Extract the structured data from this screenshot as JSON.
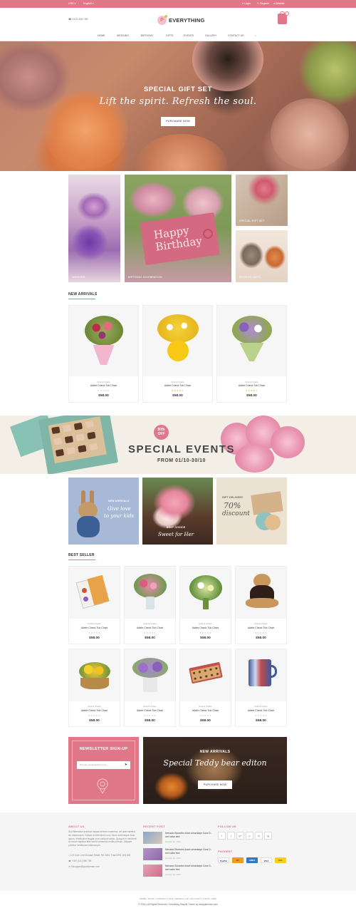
{
  "topbar": {
    "currency": "USD",
    "language": "English",
    "login": "Login",
    "register": "Register",
    "wishlist": "Wishlist"
  },
  "header": {
    "phone": "0123 456 789",
    "logo_text": "EVERYTHING",
    "cart_count": "0",
    "nav": [
      "HOME",
      "WEDDING",
      "BIRTHDAY",
      "GIFTS",
      "EVENTS",
      "GALLERY",
      "CONTACT US"
    ]
  },
  "hero": {
    "subtitle": "SPECIAL GIFT SET",
    "title": "Lift the spirit. Refresh the soul.",
    "button": "PURCHASE NOW"
  },
  "categories": {
    "wedding": "WEDDING",
    "birthday": "BIRTHDAY CELEBRATION",
    "birthday_card": "Happy Birthday",
    "gift": "SPECIAL GIFT SET",
    "plush": "STUFFED GIFTS"
  },
  "new_arrivals": {
    "title": "NEW ARRIVALS",
    "products": [
      {
        "category": "Sofa & Chairs",
        "name": "Adele Check Tub Chair",
        "price": "$58.00",
        "rating": 0
      },
      {
        "category": "Sofa & Chairs",
        "name": "Adele Check Tub Chair",
        "price": "$58.00",
        "rating": 4
      },
      {
        "category": "Sofa & Chairs",
        "name": "Adele Check Tub Chair",
        "price": "$58.00",
        "rating": 4
      }
    ]
  },
  "events_banner": {
    "badge_percent": "50%",
    "badge_off": "OFF",
    "title": "SPECIAL EVENTS",
    "date": "FROM 01/10-30/10"
  },
  "promos": {
    "bunny_tag": "NEW ARRIVALS",
    "bunny_line1": "Give love",
    "bunny_line2": "to your kids",
    "sweet_tag": "BEST CHOICE",
    "sweet_line": "Sweet for Her",
    "gift_tag": "GIFT DELIVERY",
    "gift_percent": "70%",
    "gift_line": "discount"
  },
  "best_seller": {
    "title": "BEST SELLER",
    "products": [
      {
        "category": "Sofa & Chairs",
        "name": "Adele Check Tub Chair",
        "price": "$58.00",
        "rating": 0
      },
      {
        "category": "Sofa & Chairs",
        "name": "Adele Check Tub Chair",
        "price": "$58.00",
        "rating": 0
      },
      {
        "category": "Sofa & Chairs",
        "name": "Adele Check Tub Chair",
        "price": "$58.00",
        "rating": 0
      },
      {
        "category": "Sofa & Chairs",
        "name": "Adele Check Tub Chair",
        "price": "$58.00",
        "rating": 0
      },
      {
        "category": "Sofa & Chairs",
        "name": "Adele Check Tub Chair",
        "price": "$58.00",
        "rating": 0
      },
      {
        "category": "Sofa & Chairs",
        "name": "Adele Check Tub Chair",
        "price": "$58.00",
        "rating": 0
      },
      {
        "category": "Sofa & Chairs",
        "name": "Adele Check Tub Chair",
        "price": "$58.00",
        "rating": 0
      },
      {
        "category": "Sofa & Chairs",
        "name": "Adele Check Tub Chair",
        "price": "$58.00",
        "rating": 0
      }
    ]
  },
  "newsletter": {
    "title": "NEWSLETTER SIGN-UP",
    "placeholder": "Put your email address here..."
  },
  "teddy_banner": {
    "subtitle": "NEW ARRIVALS",
    "title": "Special Teddy bear editon",
    "button": "PURCHASE NOW"
  },
  "footer": {
    "about_title": "ABOUT US",
    "about_text": "Sed Bibendum pulvinar massa et libero maximus, vel ante eleifend leo ullamcorper. Nullam in bibendum nunc. Nunc scelerisque risus ipsum, Vestibulum feugiat urna volutpat varius. Quisque in hendrerit at ornare dapibus felis sed id commodo mollis pretium. Aliquam pulvinar vestibulum ullamcorper.",
    "address": "123 Cute Line Monash Street, Rd 3000, TranS2E5, WS 839",
    "phone": "+000 (111) 456 789",
    "email": "Eshopper@yourdomain.com",
    "recent_title": "RECENT POST",
    "posts": [
      {
        "text": "Nenada Gloworks short shrankaye Cora D-sert cake bed",
        "date": "October 12, 2016"
      },
      {
        "text": "Nenada Gloworks short shrankaye Cora D-sert cake bed",
        "date": "October 12, 2016"
      },
      {
        "text": "Nenada Gloworks short shrankaye Cora D-sert cake bed",
        "date": "October 12, 2016"
      }
    ],
    "follow_title": "FOLLOW US",
    "social": [
      "f",
      "t",
      "g+",
      "p",
      "in",
      "ig"
    ],
    "payment_title": "PAYMENT",
    "payments": [
      "PayPal",
      "MC",
      "AMEX",
      "VISA",
      "DHL"
    ],
    "links": "HOME | BLOG | CONTACT | FAQ | SEARCH | MY ACCOUNT | LOGIN | RSS",
    "copyright": "© 2016 | All Rights Reserved. Everything Shopify Theme by designthemes.com"
  }
}
